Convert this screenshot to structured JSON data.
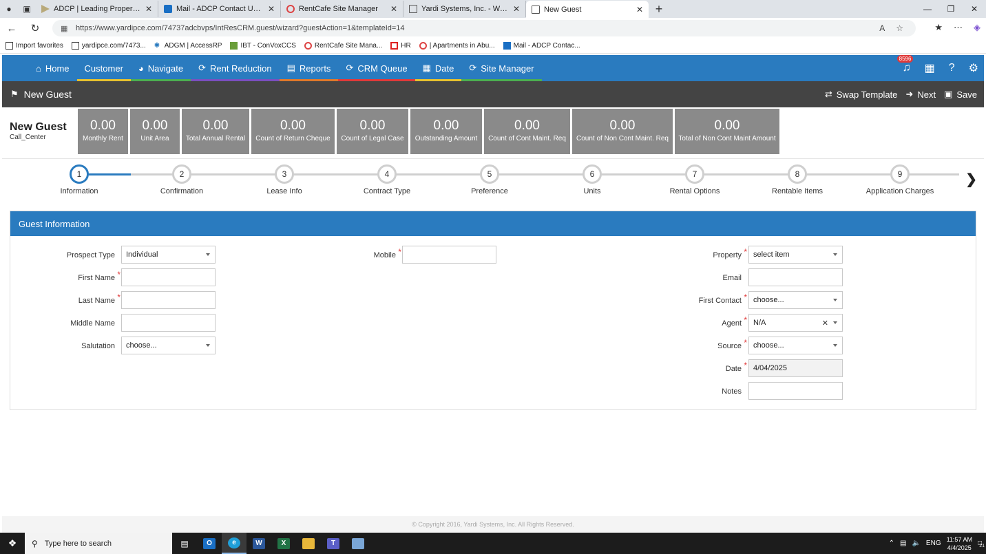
{
  "browser": {
    "tabs": [
      {
        "label": "ADCP | Leading Property Manage"
      },
      {
        "label": "Mail - ADCP Contact Us - Outlook"
      },
      {
        "label": "RentCafe Site Manager"
      },
      {
        "label": "Yardi Systems, Inc. - Work Order #"
      },
      {
        "label": "New Guest"
      }
    ],
    "new_tab": "+",
    "url": "https://www.yardipce.com/74737adcbvps/IntResCRM.guest/wizard?guestAction=1&templateId=14",
    "bookmarks": [
      {
        "label": "Import favorites"
      },
      {
        "label": "yardipce.com/7473..."
      },
      {
        "label": "ADGM | AccessRP"
      },
      {
        "label": "IBT - ConVoxCCS"
      },
      {
        "label": "RentCafe Site Mana..."
      },
      {
        "label": "HR"
      },
      {
        "label": "| Apartments in Abu..."
      },
      {
        "label": "Mail - ADCP Contac..."
      }
    ]
  },
  "nav": {
    "items": [
      {
        "label": "Home",
        "icon": "home-icon",
        "underline": "#2a7bbf"
      },
      {
        "label": "Customer",
        "icon": "",
        "underline": "#e6c12e"
      },
      {
        "label": "Navigate",
        "icon": "compass-icon",
        "underline": "#4caf50"
      },
      {
        "label": "Rent Reduction",
        "icon": "circle-arrow-icon",
        "underline": "#7b4fbf"
      },
      {
        "label": "Reports",
        "icon": "document-icon",
        "underline": "#e0782a"
      },
      {
        "label": "CRM Queue",
        "icon": "queue-icon",
        "underline": "#e03a3a"
      },
      {
        "label": "Date",
        "icon": "calendar-icon",
        "underline": "#e6c12e"
      },
      {
        "label": "Site Manager",
        "icon": "site-icon",
        "underline": "#4caf50"
      }
    ],
    "notification_count": "8596"
  },
  "titlebar": {
    "title": "New Guest",
    "swap_template": "Swap Template",
    "next": "Next",
    "save": "Save"
  },
  "guest": {
    "name": "New Guest",
    "subtitle": "Call_Center"
  },
  "kpis": [
    {
      "value": "0.00",
      "label": "Monthly Rent"
    },
    {
      "value": "0.00",
      "label": "Unit Area"
    },
    {
      "value": "0.00",
      "label": "Total Annual Rental"
    },
    {
      "value": "0.00",
      "label": "Count of Return Cheque"
    },
    {
      "value": "0.00",
      "label": "Count of Legal Case"
    },
    {
      "value": "0.00",
      "label": "Outstanding Amount"
    },
    {
      "value": "0.00",
      "label": "Count of Cont Maint. Req"
    },
    {
      "value": "0.00",
      "label": "Count of Non Cont Maint. Req"
    },
    {
      "value": "0.00",
      "label": "Total of Non Cont Maint Amount"
    }
  ],
  "steps": [
    {
      "num": "1",
      "label": "Information"
    },
    {
      "num": "2",
      "label": "Confirmation"
    },
    {
      "num": "3",
      "label": "Lease Info"
    },
    {
      "num": "4",
      "label": "Contract Type"
    },
    {
      "num": "5",
      "label": "Preference"
    },
    {
      "num": "6",
      "label": "Units"
    },
    {
      "num": "7",
      "label": "Rental Options"
    },
    {
      "num": "8",
      "label": "Rentable Items"
    },
    {
      "num": "9",
      "label": "Application Charges"
    }
  ],
  "form": {
    "section_title": "Guest Information",
    "prospect_type": {
      "label": "Prospect Type",
      "value": "Individual"
    },
    "first_name": {
      "label": "First Name",
      "value": ""
    },
    "last_name": {
      "label": "Last Name",
      "value": ""
    },
    "middle_name": {
      "label": "Middle Name",
      "value": ""
    },
    "salutation": {
      "label": "Salutation",
      "value": "choose..."
    },
    "mobile": {
      "label": "Mobile",
      "value": ""
    },
    "property": {
      "label": "Property",
      "value": "select item"
    },
    "email": {
      "label": "Email",
      "value": ""
    },
    "first_contact": {
      "label": "First Contact",
      "value": "choose..."
    },
    "agent": {
      "label": "Agent",
      "value": "N/A"
    },
    "source": {
      "label": "Source",
      "value": "choose..."
    },
    "date": {
      "label": "Date",
      "value": "4/04/2025"
    },
    "notes": {
      "label": "Notes",
      "value": ""
    }
  },
  "footer": "© Copyright 2016, Yardi Systems, Inc. All Rights Reserved.",
  "taskbar": {
    "search_placeholder": "Type here to search",
    "lang": "ENG",
    "time": "11:57 AM",
    "date": "4/4/2025",
    "notif_count": "21"
  }
}
